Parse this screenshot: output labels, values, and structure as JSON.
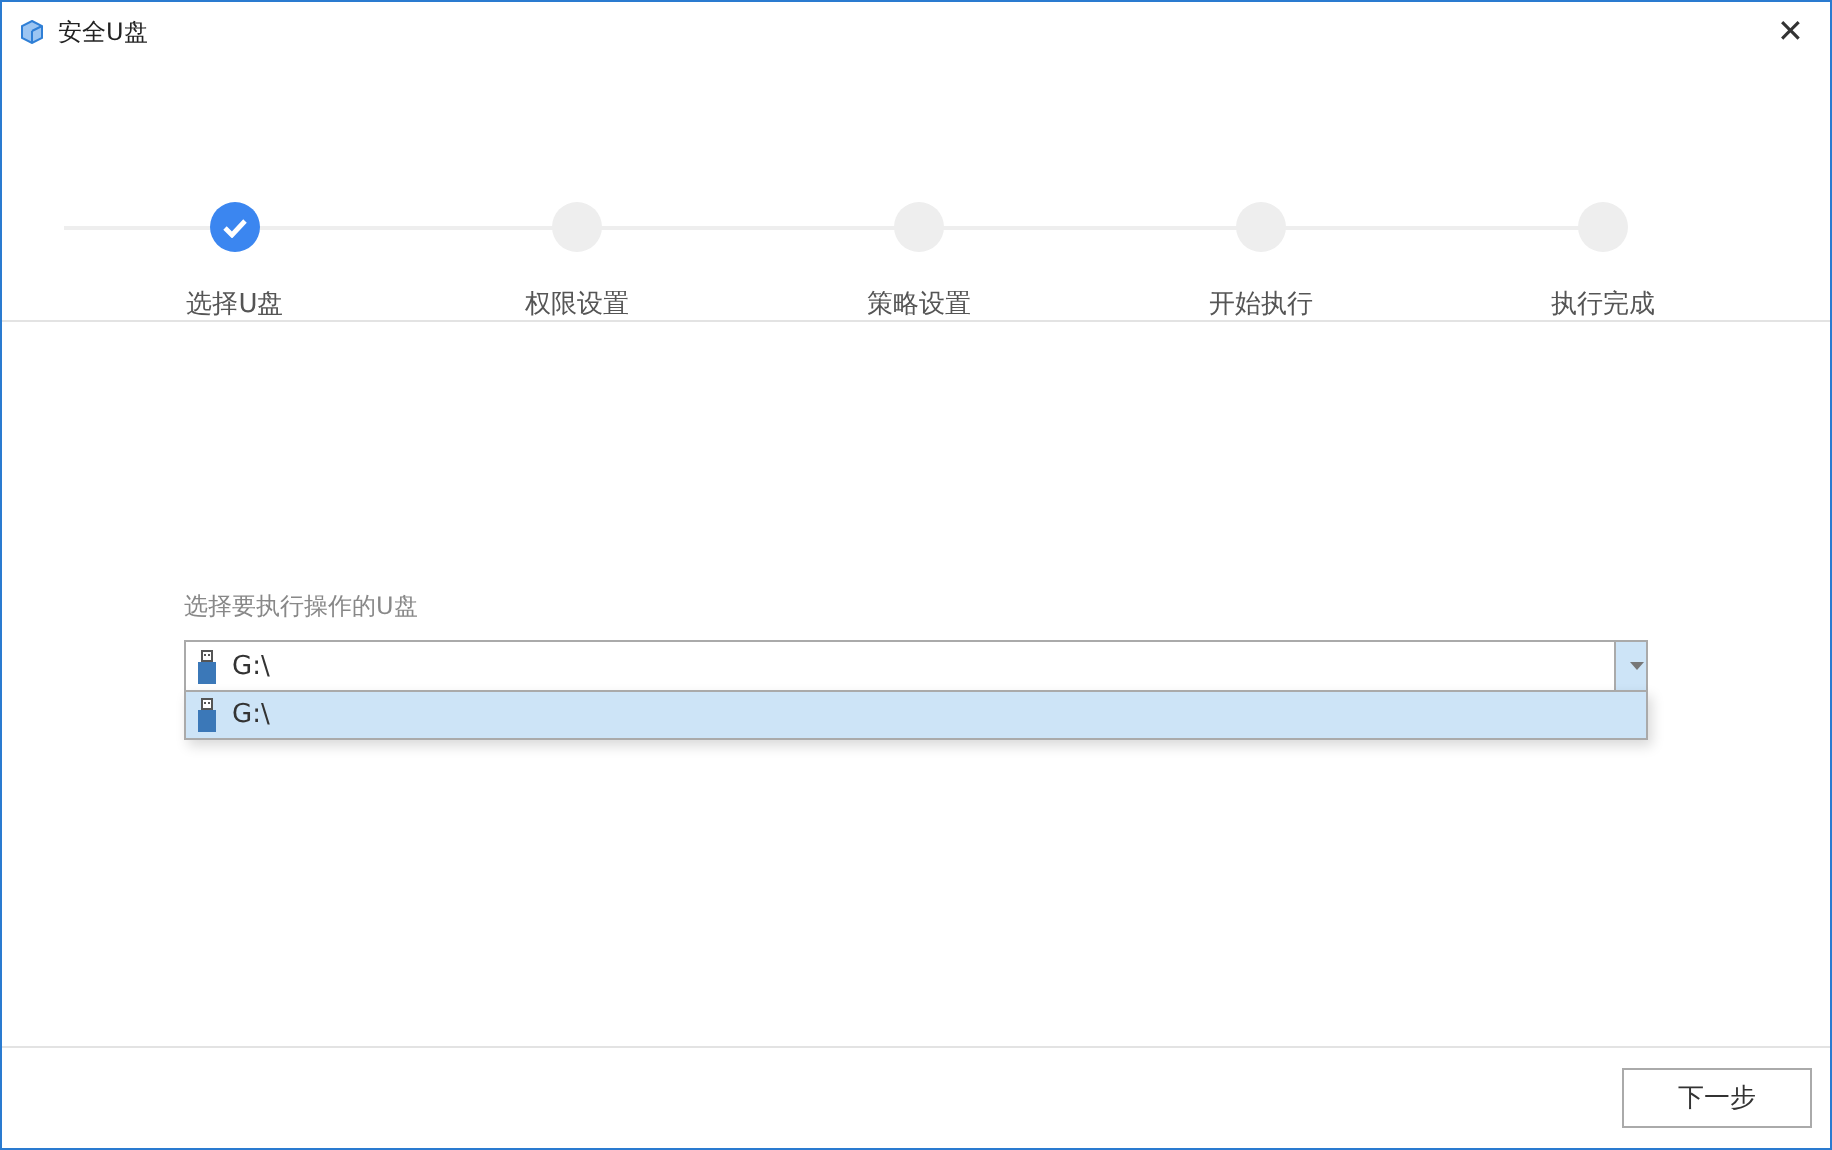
{
  "window": {
    "title": "安全U盘",
    "close": "✕"
  },
  "steps": [
    {
      "label": "选择U盘",
      "completed": true
    },
    {
      "label": "权限设置",
      "completed": false
    },
    {
      "label": "策略设置",
      "completed": false
    },
    {
      "label": "开始执行",
      "completed": false
    },
    {
      "label": "执行完成",
      "completed": false
    }
  ],
  "drive_select": {
    "label": "选择要执行操作的U盘",
    "value": "G:\\",
    "expanded": true,
    "options": [
      {
        "label": "G:\\",
        "selected": true
      }
    ]
  },
  "buttons": [
    {
      "label": "下一步"
    }
  ]
}
